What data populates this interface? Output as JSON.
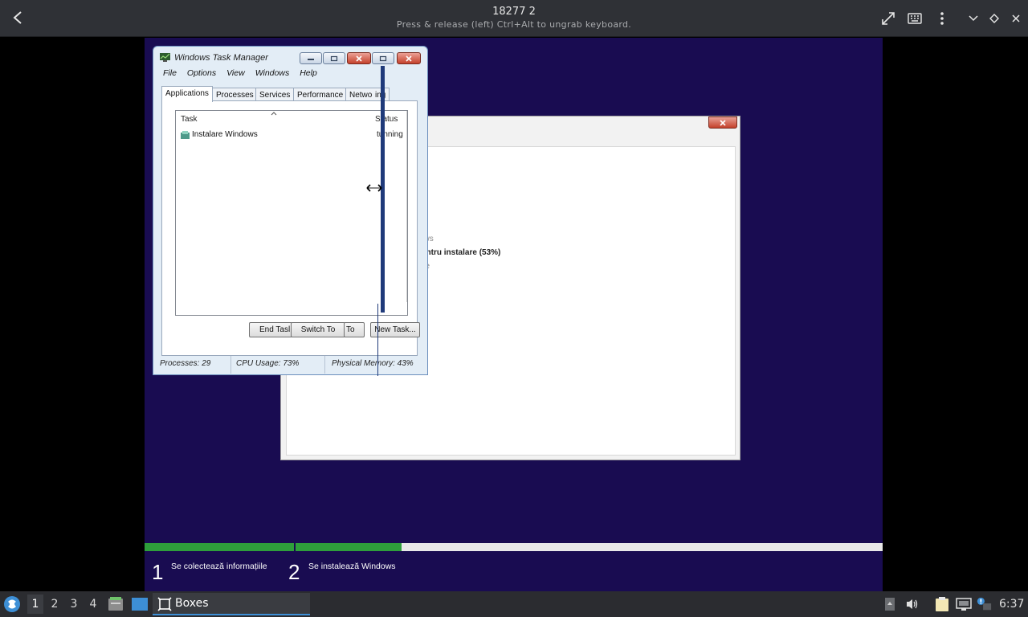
{
  "header": {
    "title": "18277 2",
    "subtitle": "Press & release (left) Ctrl+Alt to ungrab keyboard."
  },
  "task_manager": {
    "title": "Windows Task Manager",
    "menu": [
      "File",
      "Options",
      "View",
      "Windows",
      "Help"
    ],
    "tabs": [
      "Applications",
      "Processes",
      "Services",
      "Performance",
      "Netwo",
      "ing"
    ],
    "columns": {
      "task": "Task",
      "status": "Status"
    },
    "rows": [
      {
        "task": "Instalare Windows",
        "status": "Running"
      }
    ],
    "status_clipped": "tunning",
    "buttons": {
      "end_task": "End Tasl",
      "switch_to": "Switch To",
      "switch_to_clip": "To",
      "new_task": "New Task..."
    },
    "status_bar": {
      "processes": "Processes: 29",
      "cpu": "CPU Usage: 73%",
      "memory": "Physical Memory: 43%"
    }
  },
  "setup": {
    "text_a": "s",
    "text_b": "ows",
    "text_c": "entru instalare (53%)",
    "text_d": "ile"
  },
  "progress": {
    "step1_num": "1",
    "step1_label": "Se colectează informațiile",
    "step2_num": "2",
    "step2_label": "Se instalează Windows",
    "step2_fraction": 0.18
  },
  "taskbar": {
    "workspaces": [
      "1",
      "2",
      "3",
      "4"
    ],
    "active_workspace": "1",
    "task_label": "Boxes",
    "clock": "6:37"
  },
  "colors": {
    "vm_background": "#190c51",
    "progress_green": "#2e9e3b",
    "taskbar_accent": "#3d8fd6"
  }
}
